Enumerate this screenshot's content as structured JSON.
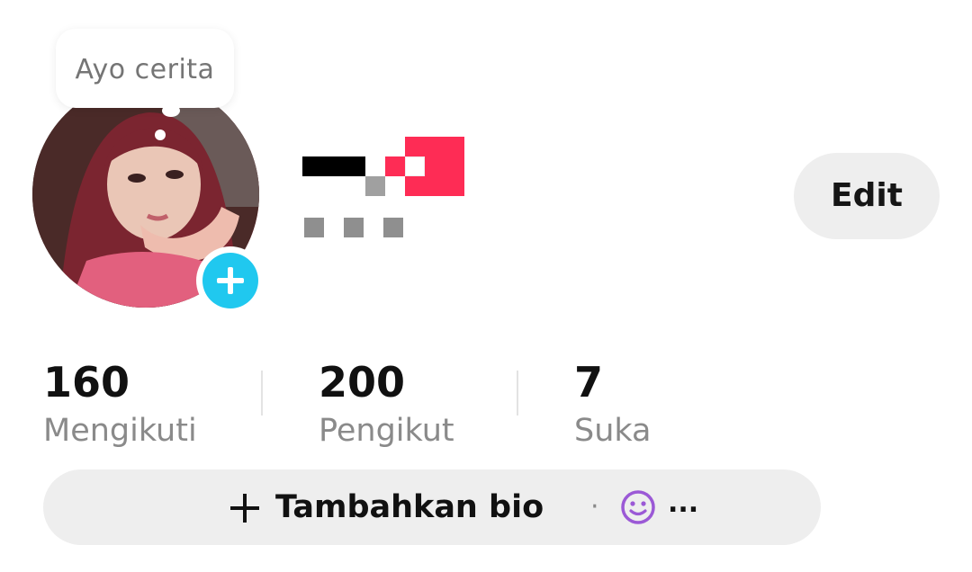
{
  "story_bubble": {
    "text": "Ayo cerita"
  },
  "profile": {
    "edit_label": "Edit"
  },
  "stats": [
    {
      "value": "160",
      "label": "Mengikuti"
    },
    {
      "value": "200",
      "label": "Pengikut"
    },
    {
      "value": "7",
      "label": "Suka"
    }
  ],
  "bio": {
    "add_label": "Tambahkan bio",
    "separator": "·",
    "more": "..."
  },
  "colors": {
    "accent_blue": "#20c8ef",
    "accent_pink": "#fe2c55",
    "emoji_purple": "#9b59d6",
    "pill_bg": "#eeeeee"
  }
}
